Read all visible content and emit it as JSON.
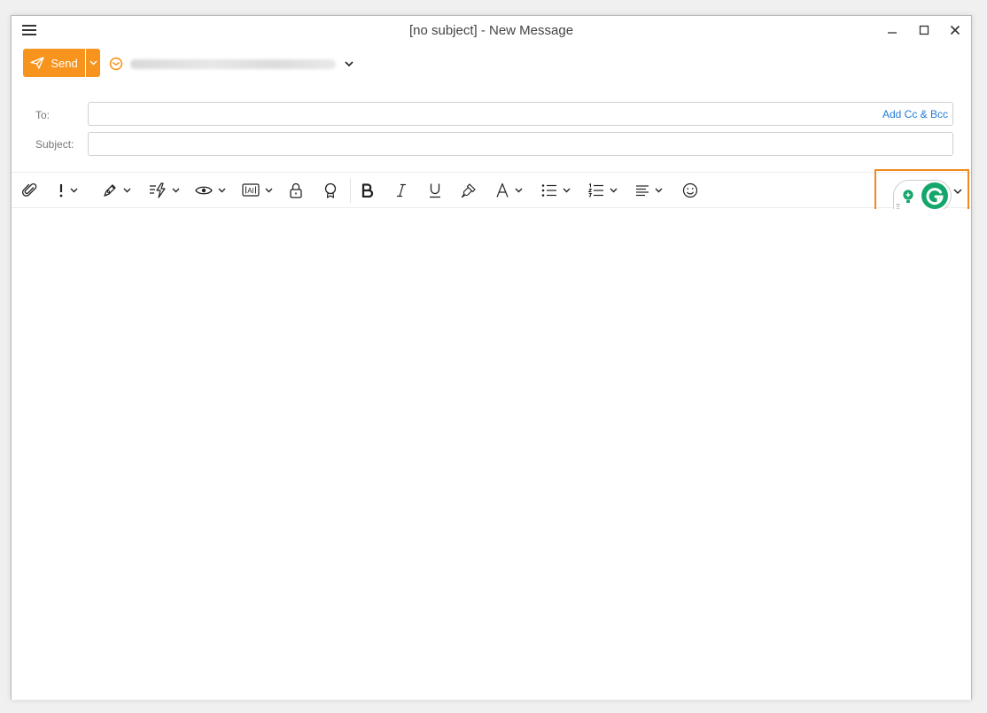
{
  "window": {
    "title": "[no subject] - New Message"
  },
  "compose": {
    "send_label": "Send",
    "to_label": "To:",
    "to_value": "",
    "subject_label": "Subject:",
    "subject_value": "",
    "add_cc_bcc": "Add Cc & Bcc",
    "from_account": "(blurred account)"
  },
  "colors": {
    "accent": "#f7941d",
    "link": "#1f7ad6",
    "grammarly": "#15a66b",
    "highlight": "#f0891e"
  },
  "toolbar": {
    "items": [
      "attach-icon",
      "priority-icon",
      "signature-icon",
      "quick-text-icon",
      "read-receipt-icon",
      "template-icon",
      "encrypt-icon",
      "certificate-icon",
      "bold-icon",
      "italic-icon",
      "underline-icon",
      "format-painter-icon",
      "font-color-icon",
      "bullet-list-icon",
      "numbered-list-icon",
      "align-icon",
      "emoji-icon"
    ]
  }
}
